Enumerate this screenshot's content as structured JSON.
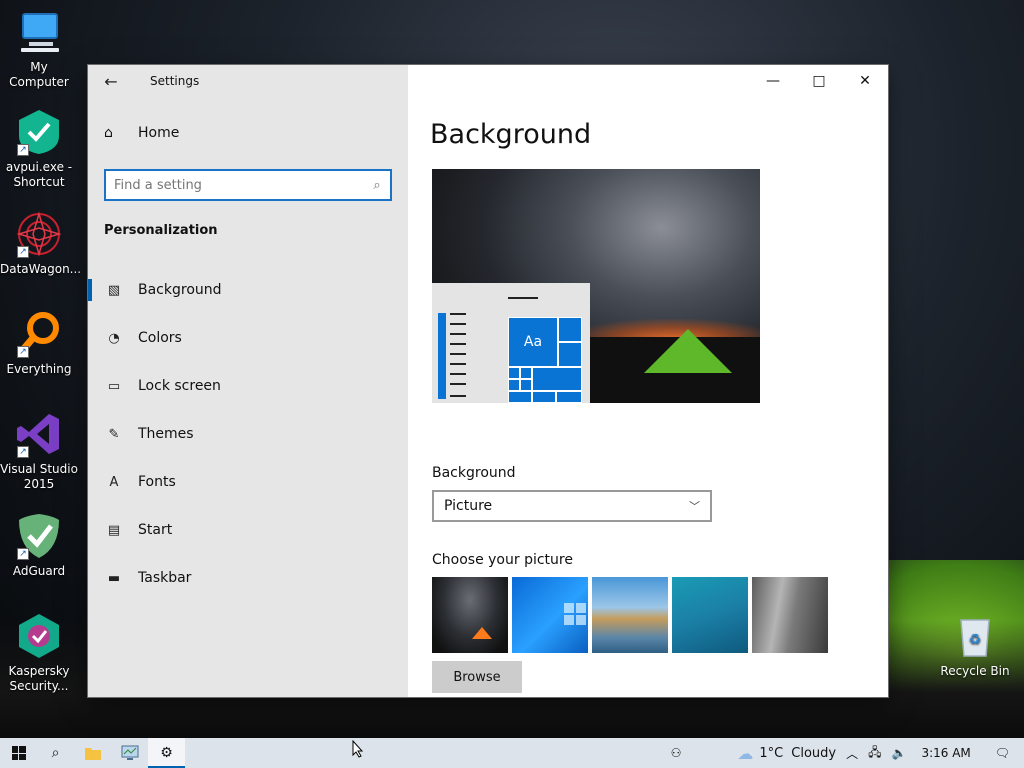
{
  "desktop": {
    "icons": [
      {
        "label": "My Computer"
      },
      {
        "label": "avpui.exe - Shortcut"
      },
      {
        "label": "DataWagon..."
      },
      {
        "label": "Everything"
      },
      {
        "label": "Visual Studio 2015"
      },
      {
        "label": "AdGuard"
      },
      {
        "label": "Kaspersky Security..."
      },
      {
        "label": "Recycle Bin"
      }
    ]
  },
  "window": {
    "title": "Settings",
    "caption": {
      "minimize": "—",
      "maximize": "□",
      "close": "✕"
    }
  },
  "sidebar": {
    "home_label": "Home",
    "search": {
      "placeholder": "Find a setting",
      "value": ""
    },
    "section_title": "Personalization",
    "items": [
      {
        "label": "Background",
        "icon": "picture-icon",
        "active": true
      },
      {
        "label": "Colors",
        "icon": "palette-icon"
      },
      {
        "label": "Lock screen",
        "icon": "monitor-icon"
      },
      {
        "label": "Themes",
        "icon": "brush-icon"
      },
      {
        "label": "Fonts",
        "icon": "font-icon"
      },
      {
        "label": "Start",
        "icon": "start-grid-icon"
      },
      {
        "label": "Taskbar",
        "icon": "taskbar-icon"
      }
    ]
  },
  "main": {
    "page_title": "Background",
    "preview": {
      "tile_text": "Aa"
    },
    "background_label": "Background",
    "background_select": {
      "selected": "Picture"
    },
    "choose_label": "Choose your picture",
    "browse_label": "Browse"
  },
  "taskbar": {
    "weather": {
      "temp": "1°C",
      "condition": "Cloudy"
    },
    "time": "3:16 AM",
    "accent": "#0063b1"
  }
}
